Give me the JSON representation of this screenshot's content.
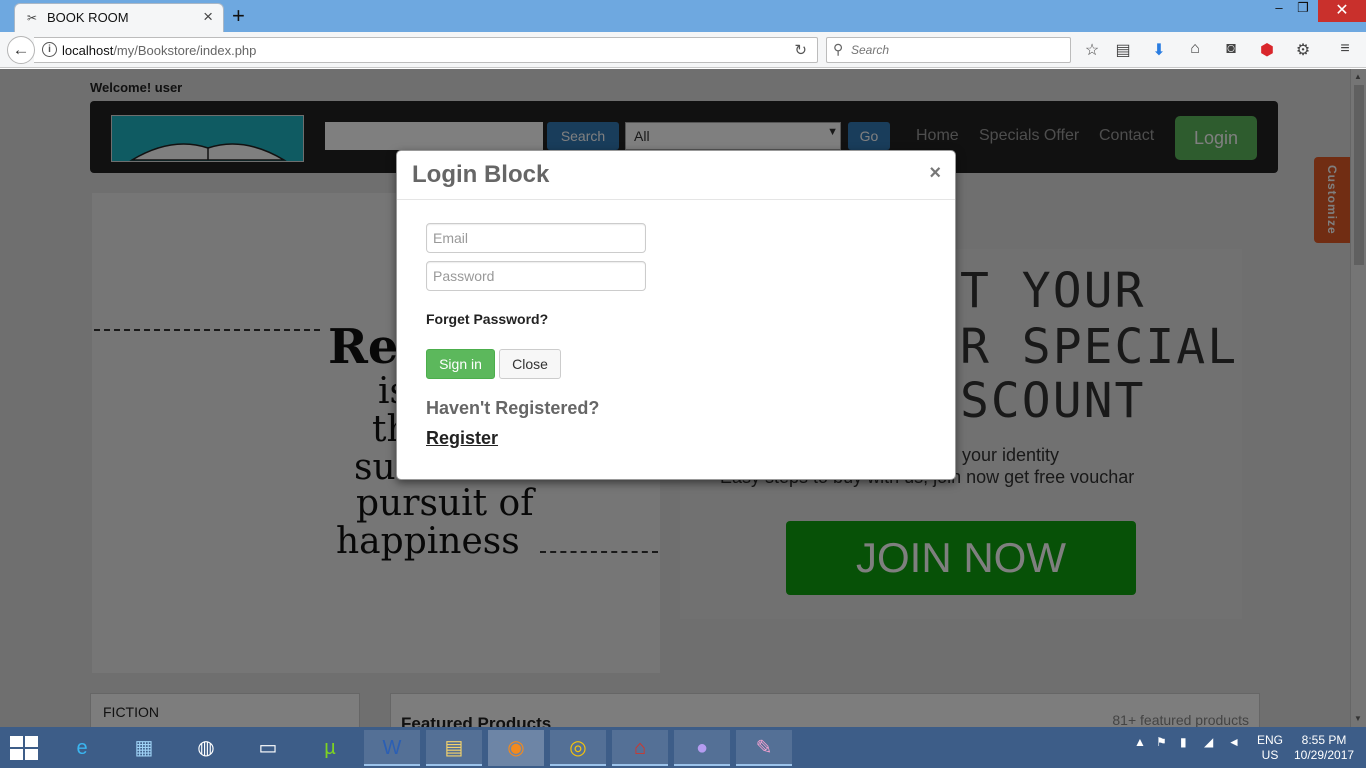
{
  "browser": {
    "tab_title": "BOOK ROOM",
    "url_host": "localhost",
    "url_path": "/my/Bookstore/index.php",
    "search_placeholder": "Search"
  },
  "site": {
    "welcome": "Welcome! user",
    "search_button": "Search",
    "category_selected": "All",
    "go_button": "Go",
    "nav": [
      "Home",
      "Specials Offer",
      "Contact"
    ],
    "login_button": "Login",
    "customize": "Customize",
    "quote_lines": [
      "Re",
      "is",
      "th",
      "su",
      "pursuit of",
      "happiness"
    ],
    "promo_lines": [
      "T YOUR",
      "R SPECIAL",
      "SCOUNT"
    ],
    "promo_sub1": "your identity",
    "promo_sub2": "Easy steps to buy with us, join now get free vouchar",
    "join_button": "JOIN NOW",
    "fiction": "FICTION",
    "featured": "Featured Products",
    "featured_count": "81+ featured products"
  },
  "modal": {
    "title": "Login Block",
    "close_symbol": "×",
    "email_placeholder": "Email",
    "password_placeholder": "Password",
    "forgot": "Forget Password?",
    "signin": "Sign in",
    "close": "Close",
    "not_registered": "Haven't Registered?",
    "register": "Register"
  },
  "taskbar": {
    "lang": "ENG",
    "region": "US",
    "time": "8:55 PM",
    "date": "10/29/2017"
  },
  "colors": {
    "success": "#5cb85c",
    "primary": "#337ab7",
    "taskbar": "#3d5d88"
  }
}
